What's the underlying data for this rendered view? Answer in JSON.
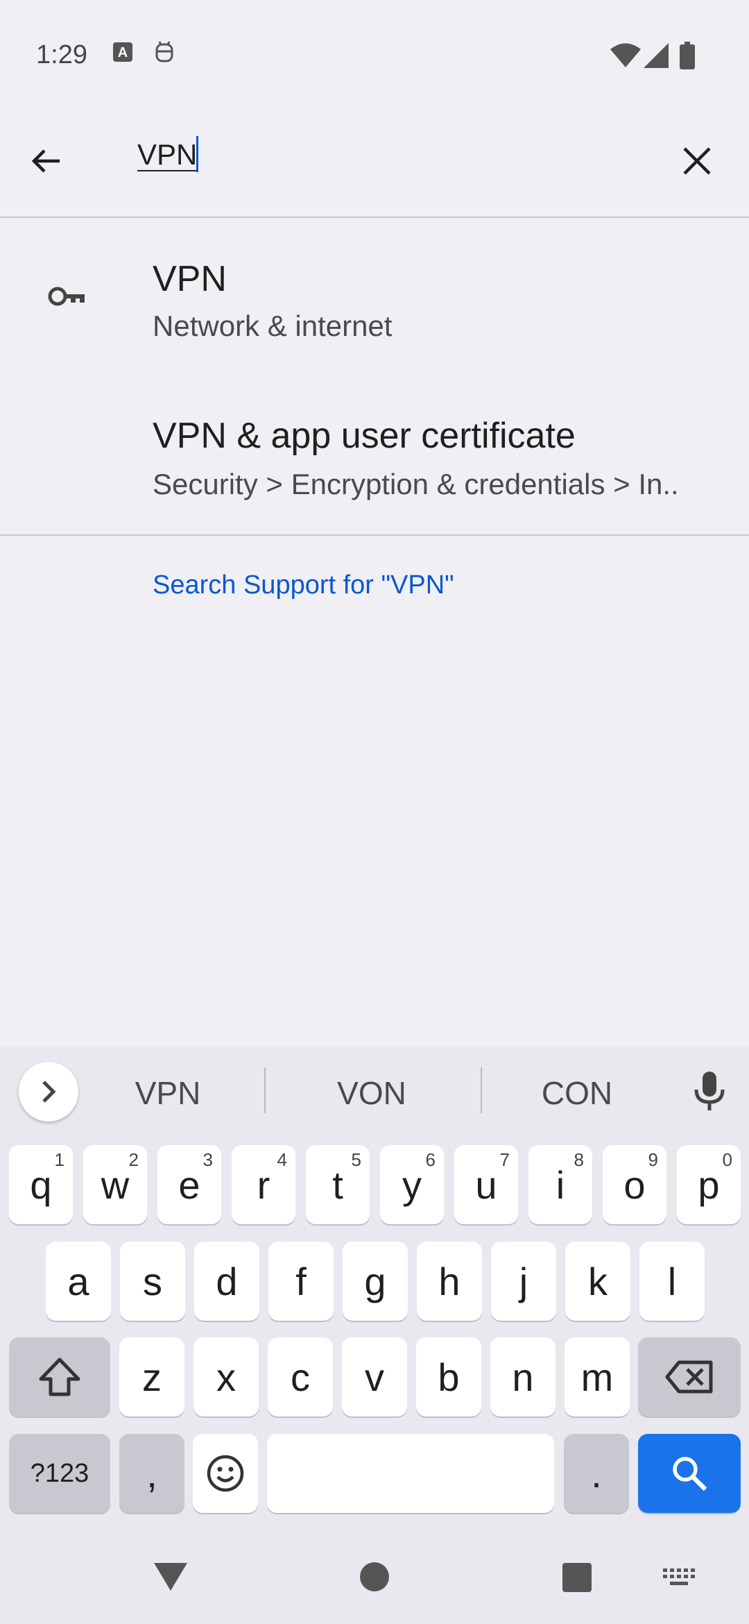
{
  "status_bar": {
    "time": "1:29"
  },
  "search": {
    "value": "VPN"
  },
  "results": [
    {
      "title": "VPN",
      "subtitle": "Network & internet",
      "icon": "key-icon"
    },
    {
      "title": "VPN & app user certificate",
      "subtitle": "Security > Encryption & credentials > In.."
    }
  ],
  "support_link": "Search Support for \"VPN\"",
  "keyboard": {
    "suggestions": [
      "VPN",
      "VON",
      "CON"
    ],
    "row1": [
      {
        "k": "q",
        "s": "1"
      },
      {
        "k": "w",
        "s": "2"
      },
      {
        "k": "e",
        "s": "3"
      },
      {
        "k": "r",
        "s": "4"
      },
      {
        "k": "t",
        "s": "5"
      },
      {
        "k": "y",
        "s": "6"
      },
      {
        "k": "u",
        "s": "7"
      },
      {
        "k": "i",
        "s": "8"
      },
      {
        "k": "o",
        "s": "9"
      },
      {
        "k": "p",
        "s": "0"
      }
    ],
    "row2": [
      "a",
      "s",
      "d",
      "f",
      "g",
      "h",
      "j",
      "k",
      "l"
    ],
    "row3": [
      "z",
      "x",
      "c",
      "v",
      "b",
      "n",
      "m"
    ],
    "symbols_label": "?123",
    "comma_label": ",",
    "period_label": "."
  },
  "colors": {
    "accent": "#0b57d0",
    "search_key": "#1a73e8",
    "background": "#f0eff4"
  }
}
